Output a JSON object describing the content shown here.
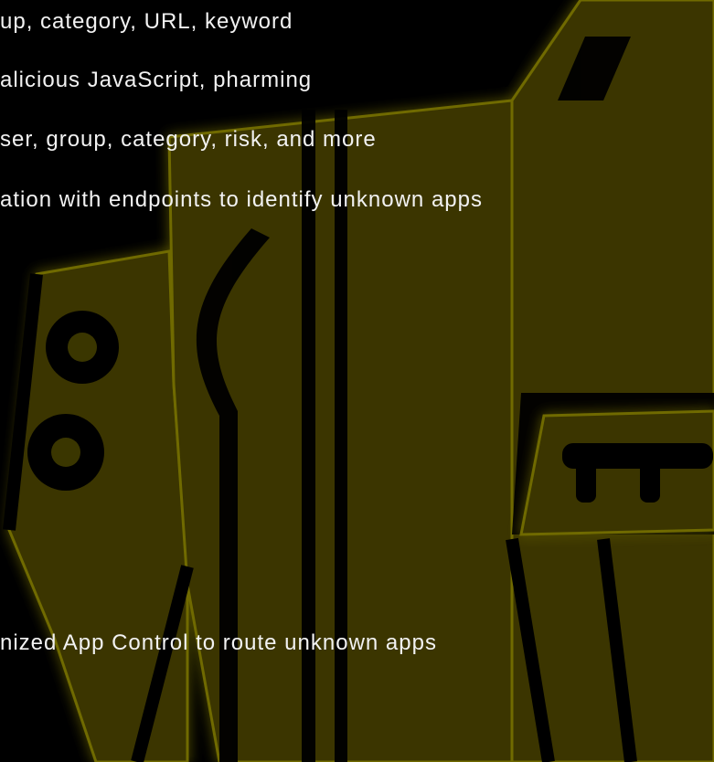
{
  "background_color": "#000000",
  "artwork": {
    "description_icon": "strap-lock-icon",
    "fill_color": "#3a3600",
    "glow_color": "#7a7400"
  },
  "text_lines": [
    "up, category, URL, keyword",
    "alicious JavaScript, pharming",
    "ser, group, category, risk, and more",
    "ation with endpoints to identify unknown apps",
    "nized App Control to route unknown apps"
  ]
}
